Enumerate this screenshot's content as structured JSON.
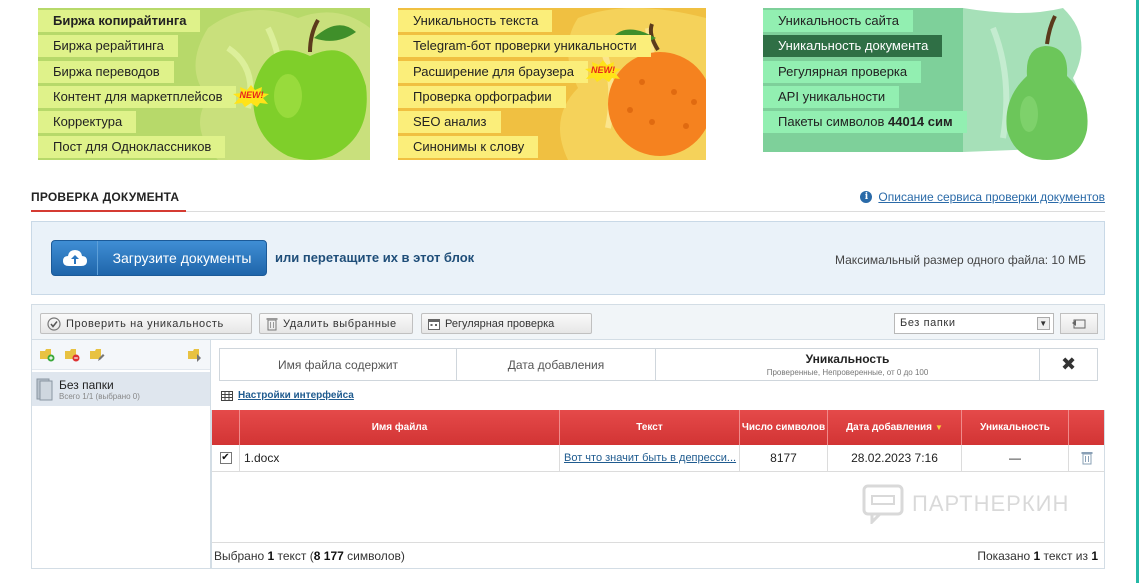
{
  "banner": {
    "green_menu": [
      {
        "label": "Биржа копирайтинга",
        "bold": true
      },
      {
        "label": "Биржа рерайтинга"
      },
      {
        "label": "Биржа переводов"
      },
      {
        "label": "Контент для маркетплейсов",
        "badge": "NEW!"
      },
      {
        "label": "Корректура"
      },
      {
        "label": "Пост для Одноклассников"
      }
    ],
    "orange_menu": [
      {
        "label": "Уникальность текста"
      },
      {
        "label": "Telegram-бот проверки уникальности"
      },
      {
        "label": "Расширение для браузера",
        "badge": "NEW!"
      },
      {
        "label": "Проверка орфографии"
      },
      {
        "label": "SEO анализ"
      },
      {
        "label": "Синонимы к слову"
      }
    ],
    "mint_menu": [
      {
        "label": "Уникальность сайта"
      },
      {
        "label": "Уникальность документа",
        "selected": true
      },
      {
        "label": "Регулярная проверка"
      },
      {
        "label": "API уникальности"
      },
      {
        "label": "Пакеты символов",
        "count": "44014 сим"
      }
    ],
    "colors": {
      "green": "#b7d96a",
      "orange": "#f0c041",
      "mint": "#92efb1",
      "selected": "#2f6f45"
    }
  },
  "section": {
    "title": "ПРОВЕРКА ДОКУМЕНТА",
    "help_link": "Описание сервиса проверки документов",
    "help_icon": "info-icon"
  },
  "upload": {
    "button_label": "Загрузите документы",
    "drag_text": "или перетащите их в этот блок",
    "max_size": "Максимальный размер одного файла: 10 МБ"
  },
  "toolbar": {
    "check_label": "Проверить на уникальность",
    "delete_label": "Удалить выбранные",
    "regular_label": "Регулярная проверка",
    "folder_selected": "Без папки"
  },
  "folders": {
    "name": "Без папки",
    "count": "Всего 1/1 (выбрано 0)"
  },
  "filters": {
    "name_label": "Имя файла содержит",
    "date_label": "Дата добавления",
    "unique_label": "Уникальность",
    "unique_sub": "Проверенные, Непроверенные, от 0 до 100"
  },
  "settings_link": "Настройки интерфейса",
  "table": {
    "columns": [
      "Имя файла",
      "Текст",
      "Число символов",
      "Дата добавления",
      "Уникальность"
    ],
    "rows": [
      {
        "checked": true,
        "file": "1.docx",
        "text": "Вот что значит быть в депресси...",
        "chars": "8177",
        "date": "28.02.2023 7:16",
        "unique": "—"
      }
    ],
    "footer_left": {
      "prefix": "Выбрано ",
      "count": "1",
      "middle": " текст (",
      "chars": "8 177",
      "suffix": " символов)"
    },
    "footer_right": {
      "prefix": "Показано ",
      "shown": "1",
      "middle": " текст из ",
      "total": "1"
    }
  },
  "watermark": "ПАРТНЕРКИН"
}
